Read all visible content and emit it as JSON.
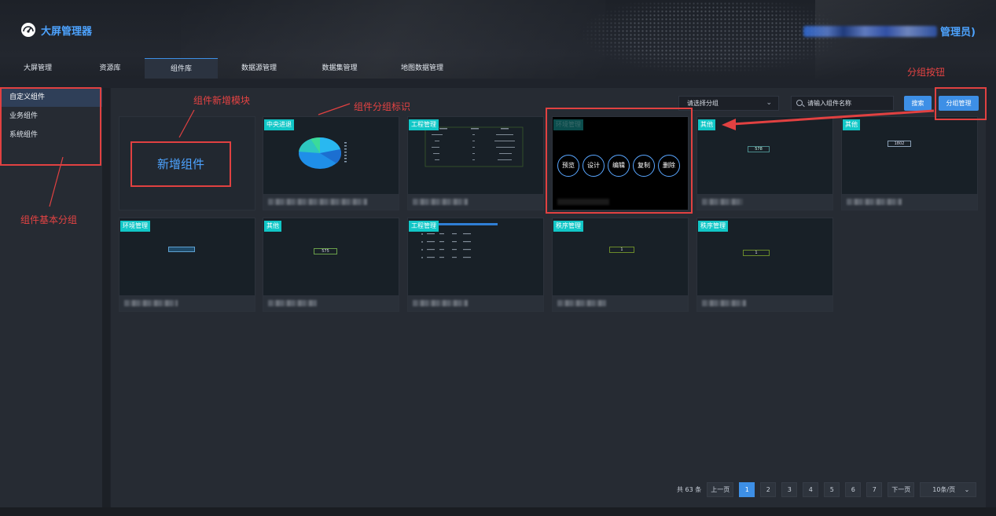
{
  "header": {
    "app_name": "大屏管理器",
    "user_role": "管理员)",
    "tabs": [
      "大屏管理",
      "资源库",
      "组件库",
      "数据源管理",
      "数据集管理",
      "地图数据管理"
    ],
    "active_tab": "组件库"
  },
  "sidebar": {
    "items": [
      {
        "label": "自定义组件",
        "active": true
      },
      {
        "label": "业务组件",
        "active": false
      },
      {
        "label": "系统组件",
        "active": false
      }
    ]
  },
  "toolbar": {
    "group_select_placeholder": "请选择分组",
    "search_placeholder": "请输入组件名称",
    "search_button": "搜索",
    "group_manage_button": "分组管理"
  },
  "cards": {
    "add_label": "新增组件",
    "tags": [
      "中央进退",
      "工程管理",
      "环境管理",
      "其他",
      "其他",
      "环境管理",
      "其他",
      "工程管理",
      "秩序管理",
      "秩序管理"
    ],
    "hover_actions": [
      "预览",
      "设计",
      "编辑",
      "复制",
      "删除"
    ],
    "mini_values": {
      "a": "578",
      "b": "1802",
      "c": "575",
      "d": "1",
      "e": "1"
    }
  },
  "pagination": {
    "total": "共 63 条",
    "prev": "上一页",
    "next": "下一页",
    "pages": [
      "1",
      "2",
      "3",
      "4",
      "5",
      "6",
      "7"
    ],
    "current": "1",
    "page_size": "10条/页"
  },
  "annotations": {
    "add_module": "组件新增模块",
    "group_tag": "组件分组标识",
    "basic_group": "组件基本分组",
    "group_button": "分组按钮"
  },
  "colors": {
    "accent": "#3d8fe6",
    "tag": "#11c7c7",
    "annotation": "#e14141"
  }
}
